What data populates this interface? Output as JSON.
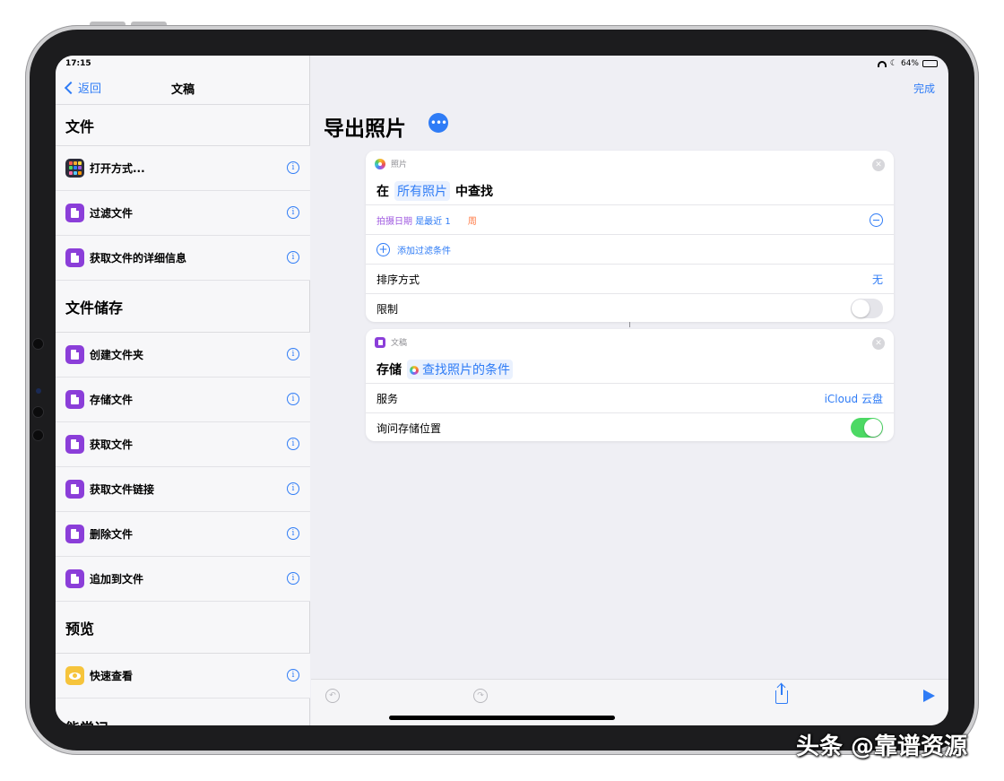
{
  "status_bar": {
    "time": "17:15",
    "battery": "64%",
    "battery_fraction": 0.64
  },
  "sidebar": {
    "back_label": "返回",
    "title": "文稿",
    "sections": [
      {
        "header": "文件",
        "items": [
          {
            "label": "打开方式...",
            "icon": "app-grid-icon"
          },
          {
            "label": "过滤文件",
            "icon": "document-icon"
          },
          {
            "label": "获取文件的详细信息",
            "icon": "document-icon"
          }
        ]
      },
      {
        "header": "文件储存",
        "items": [
          {
            "label": "创建文件夹",
            "icon": "document-icon"
          },
          {
            "label": "存储文件",
            "icon": "document-icon"
          },
          {
            "label": "获取文件",
            "icon": "document-icon"
          },
          {
            "label": "获取文件链接",
            "icon": "document-icon"
          },
          {
            "label": "删除文件",
            "icon": "document-icon"
          },
          {
            "label": "追加到文件",
            "icon": "document-icon"
          }
        ]
      },
      {
        "header": "预览",
        "items": [
          {
            "label": "快速查看",
            "icon": "eye-icon"
          }
        ]
      }
    ],
    "cut_header": "能常记"
  },
  "main": {
    "done_label": "完成",
    "title": "导出照片",
    "card1": {
      "app": "照片",
      "action_prefix": "在",
      "action_token": "所有照片",
      "action_suffix": "中查找",
      "filter_field": "拍摄日期",
      "filter_op": "是最近 1",
      "filter_unit": "周",
      "add_filter": "添加过滤条件",
      "sort_label": "排序方式",
      "sort_value": "无",
      "limit_label": "限制",
      "limit_on": false
    },
    "card2": {
      "app": "文稿",
      "action_prefix": "存储",
      "action_token": "查找照片的条件",
      "service_label": "服务",
      "service_value": "iCloud 云盘",
      "ask_label": "询问存储位置",
      "ask_on": true
    }
  },
  "watermark": "头条 @靠谱资源",
  "colors": {
    "accent": "#2f7cf6",
    "doc_purple": "#8b3ed9",
    "toggle_on": "#4cd964",
    "filter_purple": "#a05be0",
    "filter_orange": "#ff7a45"
  }
}
